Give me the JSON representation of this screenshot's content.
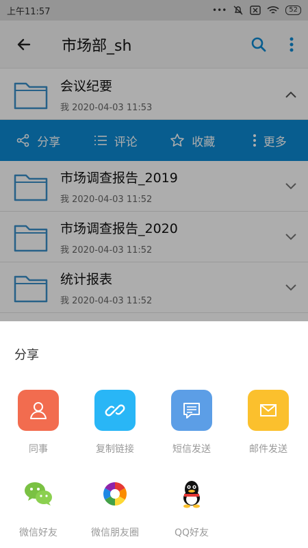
{
  "status": {
    "time": "上午11:57",
    "signal_dots": "•••",
    "battery": "52"
  },
  "appbar": {
    "title": "市场部_sh",
    "back_icon": "arrow-left-icon",
    "search_icon": "search-icon",
    "more_icon": "more-vertical-icon"
  },
  "files": [
    {
      "name": "会议纪要",
      "meta": "我 2020-04-03 11:53",
      "expanded": true
    },
    {
      "name": "市场调查报告_2019",
      "meta": "我 2020-04-03 11:52",
      "expanded": false
    },
    {
      "name": "市场调查报告_2020",
      "meta": "我 2020-04-03 11:52",
      "expanded": false
    },
    {
      "name": "统计报表",
      "meta": "我 2020-04-03 11:52",
      "expanded": false
    }
  ],
  "actions": {
    "share": "分享",
    "comment": "评论",
    "favorite": "收藏",
    "more": "更多"
  },
  "sheet": {
    "title": "分享",
    "items": [
      {
        "label": "同事",
        "icon": "colleague-icon",
        "color": "#f26c4f"
      },
      {
        "label": "复制链接",
        "icon": "link-icon",
        "color": "#29b6f6"
      },
      {
        "label": "短信发送",
        "icon": "sms-icon",
        "color": "#5c9ee6"
      },
      {
        "label": "邮件发送",
        "icon": "mail-icon",
        "color": "#fbc02d"
      },
      {
        "label": "微信好友",
        "icon": "wechat-icon",
        "color": "#7ac143"
      },
      {
        "label": "微信朋友圈",
        "icon": "moments-icon",
        "color": "#f5a623"
      },
      {
        "label": "QQ好友",
        "icon": "qq-icon",
        "color": "#111111"
      }
    ]
  },
  "colors": {
    "accent": "#0c8ad3",
    "folder": "#3a8fc9"
  }
}
